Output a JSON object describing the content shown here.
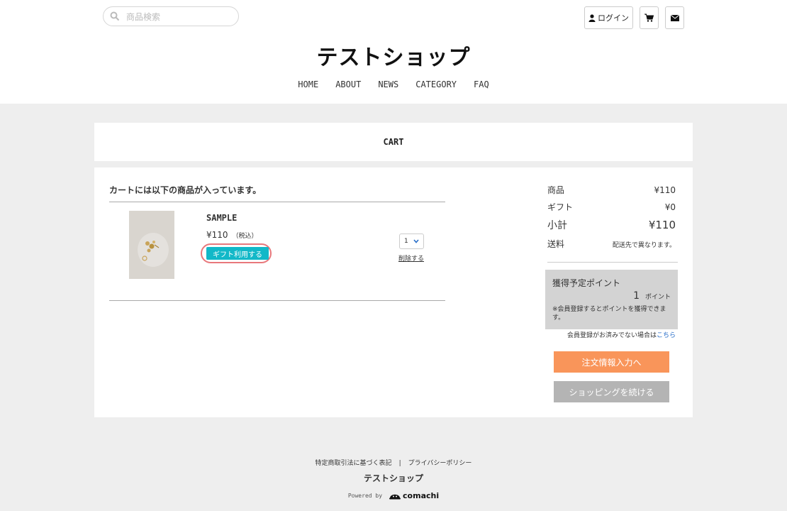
{
  "header": {
    "search_placeholder": "商品検索",
    "login_label": "ログイン",
    "shop_name": "テストショップ",
    "nav": [
      "HOME",
      "ABOUT",
      "NEWS",
      "CATEGORY",
      "FAQ"
    ]
  },
  "page_title": "CART",
  "cart": {
    "heading": "カートには以下の商品が入っています。",
    "items": [
      {
        "name": "SAMPLE",
        "price": "¥110",
        "tax_note": "（税込）",
        "gift_button": "ギフト利用する",
        "quantity": "1",
        "remove_label": "削除する"
      }
    ]
  },
  "summary": {
    "product_label": "商品",
    "product_value": "¥110",
    "gift_label": "ギフト",
    "gift_value": "¥0",
    "subtotal_label": "小計",
    "subtotal_value": "¥110",
    "shipping_label": "送料",
    "shipping_value": "配送先で異なります。"
  },
  "points": {
    "title": "獲得予定ポイント",
    "value": "1",
    "unit": "ポイント",
    "note": "※会員登録するとポイントを獲得できます。"
  },
  "register_note": "会員登録がお済みでない場合は",
  "register_link": "こちら",
  "buttons": {
    "order": "注文情報入力へ",
    "continue": "ショッピングを続ける"
  },
  "footer": {
    "legal": "特定商取引法に基づく表記",
    "separator": "|",
    "privacy": "プライバシーポリシー",
    "shop_name": "テストショップ",
    "powered_by": "Powered by",
    "brand": "comachi"
  },
  "colors": {
    "gift_button": "#12b8c8",
    "gift_highlight": "#e8787c",
    "order_button": "#f9955a",
    "continue_button": "#b4b4b4",
    "link": "#2a6fc9",
    "background": "#eeeeee"
  }
}
